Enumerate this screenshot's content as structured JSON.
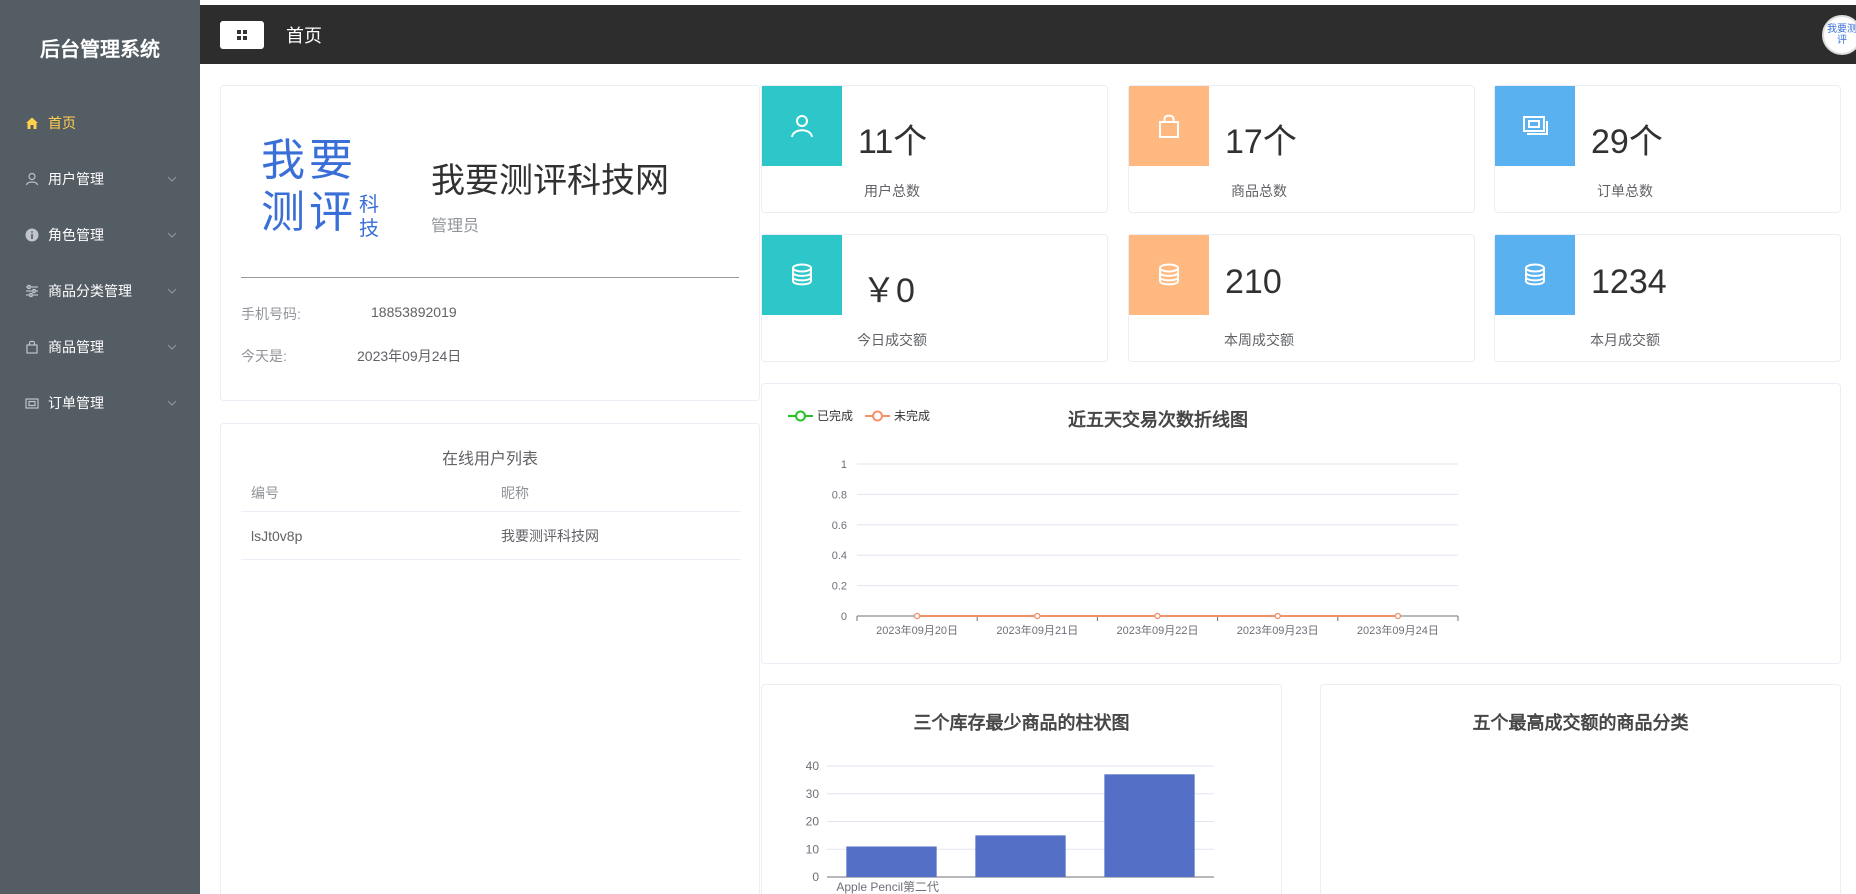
{
  "app": {
    "title": "后台管理系统"
  },
  "sidebar": {
    "items": [
      {
        "label": "首页",
        "icon": "home-icon",
        "active": true,
        "has_children": false
      },
      {
        "label": "用户管理",
        "icon": "user-icon",
        "has_children": true
      },
      {
        "label": "角色管理",
        "icon": "info-icon",
        "has_children": true
      },
      {
        "label": "商品分类管理",
        "icon": "sliders-icon",
        "has_children": true
      },
      {
        "label": "商品管理",
        "icon": "bag-icon",
        "has_children": true
      },
      {
        "label": "订单管理",
        "icon": "order-icon",
        "has_children": true
      }
    ],
    "colors": {
      "background": "#545c64",
      "active_text": "#ffd04b"
    }
  },
  "header": {
    "title": "首页",
    "avatar_text": "我要测评"
  },
  "profile": {
    "logo_text": [
      "我要",
      "测评",
      "科技"
    ],
    "site_name": "我要测评科技网",
    "role": "管理员",
    "phone_label": "手机号码:",
    "phone": "18853892019",
    "today_label": "今天是:",
    "today": "2023年09月24日"
  },
  "online_users": {
    "title": "在线用户列表",
    "columns": [
      "编号",
      "昵称"
    ],
    "rows": [
      {
        "id": "lsJt0v8p",
        "nickname": "我要测评科技网"
      }
    ]
  },
  "stats": [
    {
      "value": "11个",
      "label": "用户总数",
      "color": "#2ec7c9",
      "icon": "user-icon"
    },
    {
      "value": "17个",
      "label": "商品总数",
      "color": "#ffb980",
      "icon": "bag-icon"
    },
    {
      "value": "29个",
      "label": "订单总数",
      "color": "#5ab1ef",
      "icon": "money-icon"
    },
    {
      "value": "￥0",
      "label": "今日成交额",
      "color": "#2ec7c9",
      "icon": "coins-icon"
    },
    {
      "value": "210",
      "label": "本周成交额",
      "color": "#ffb980",
      "icon": "coins-icon"
    },
    {
      "value": "1234",
      "label": "本月成交额",
      "color": "#5ab1ef",
      "icon": "coins-icon"
    }
  ],
  "chart_data": [
    {
      "type": "line",
      "title": "近五天交易次数折线图",
      "x": [
        "2023年09月20日",
        "2023年09月21日",
        "2023年09月22日",
        "2023年09月23日",
        "2023年09月24日"
      ],
      "series": [
        {
          "name": "已完成",
          "values": [
            0,
            0,
            0,
            0,
            0
          ],
          "color": "#22c322"
        },
        {
          "name": "未完成",
          "values": [
            0,
            0,
            0,
            0,
            0
          ],
          "color": "#f4916b"
        }
      ],
      "yticks": [
        "0",
        "0.2",
        "0.4",
        "0.6",
        "0.8",
        "1"
      ],
      "ylim": [
        0,
        1
      ],
      "legend": "top-left",
      "grid": true
    },
    {
      "type": "bar",
      "title": "三个库存最少商品的柱状图",
      "categories": [
        "Apple Pencil第二代",
        "",
        ""
      ],
      "values": [
        11,
        15,
        37
      ],
      "yticks": [
        "0",
        "10",
        "20",
        "30",
        "40"
      ],
      "ylim": [
        0,
        40
      ],
      "color": "#5470c6",
      "grid": true
    },
    {
      "type": "pie",
      "title": "五个最高成交额的商品分类"
    }
  ]
}
